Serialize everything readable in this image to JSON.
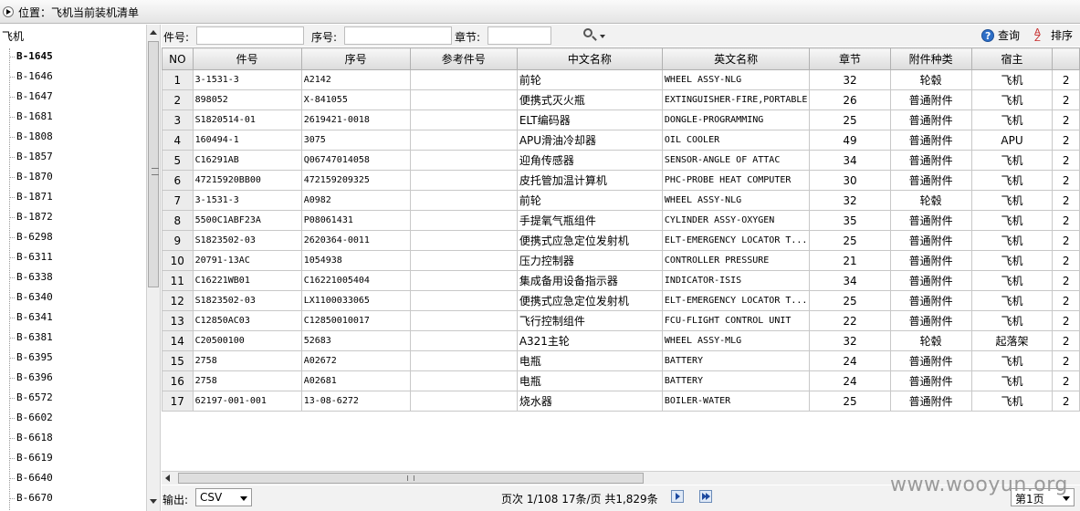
{
  "titlebar": {
    "location": "位置：飞机当前装机清单"
  },
  "tree": {
    "root": "飞机",
    "items": [
      "B-1645",
      "B-1646",
      "B-1647",
      "B-1681",
      "B-1808",
      "B-1857",
      "B-1870",
      "B-1871",
      "B-1872",
      "B-6298",
      "B-6311",
      "B-6338",
      "B-6340",
      "B-6341",
      "B-6381",
      "B-6395",
      "B-6396",
      "B-6572",
      "B-6602",
      "B-6618",
      "B-6619",
      "B-6640",
      "B-6670"
    ]
  },
  "filters": {
    "part_label": "件号:",
    "part_value": "",
    "serial_label": "序号:",
    "serial_value": "",
    "chapter_label": "章节:",
    "chapter_value": "",
    "query_label": "查询",
    "sort_label": "排序"
  },
  "table": {
    "columns": [
      "NO",
      "件号",
      "序号",
      "参考件号",
      "中文名称",
      "英文名称",
      "章节",
      "附件种类",
      "宿主"
    ],
    "rows": [
      [
        "1",
        "3-1531-3",
        "A2142",
        "",
        "前轮",
        "WHEEL ASSY-NLG",
        "32",
        "轮毂",
        "飞机",
        "2"
      ],
      [
        "2",
        "898052",
        "X-841055",
        "",
        "便携式灭火瓶",
        "EXTINGUISHER-FIRE,PORTABLE",
        "26",
        "普通附件",
        "飞机",
        "2"
      ],
      [
        "3",
        "S1820514-01",
        "2619421-0018",
        "",
        "ELT编码器",
        "DONGLE-PROGRAMMING",
        "25",
        "普通附件",
        "飞机",
        "2"
      ],
      [
        "4",
        "160494-1",
        "3075",
        "",
        "APU滑油冷却器",
        "OIL COOLER",
        "49",
        "普通附件",
        "APU",
        "2"
      ],
      [
        "5",
        "C16291AB",
        "Q06747014058",
        "",
        "迎角传感器",
        "SENSOR-ANGLE OF ATTAC",
        "34",
        "普通附件",
        "飞机",
        "2"
      ],
      [
        "6",
        "47215920BB00",
        "472159209325",
        "",
        "皮托管加温计算机",
        "PHC-PROBE HEAT COMPUTER",
        "30",
        "普通附件",
        "飞机",
        "2"
      ],
      [
        "7",
        "3-1531-3",
        "A0982",
        "",
        "前轮",
        "WHEEL ASSY-NLG",
        "32",
        "轮毂",
        "飞机",
        "2"
      ],
      [
        "8",
        "5500C1ABF23A",
        "P08061431",
        "",
        "手提氧气瓶组件",
        "CYLINDER ASSY-OXYGEN",
        "35",
        "普通附件",
        "飞机",
        "2"
      ],
      [
        "9",
        "S1823502-03",
        "2620364-0011",
        "",
        "便携式应急定位发射机",
        "ELT-EMERGENCY LOCATOR T...",
        "25",
        "普通附件",
        "飞机",
        "2"
      ],
      [
        "10",
        "20791-13AC",
        "1054938",
        "",
        "压力控制器",
        "CONTROLLER PRESSURE",
        "21",
        "普通附件",
        "飞机",
        "2"
      ],
      [
        "11",
        "C16221WB01",
        "C16221005404",
        "",
        "集成备用设备指示器",
        "INDICATOR-ISIS",
        "34",
        "普通附件",
        "飞机",
        "2"
      ],
      [
        "12",
        "S1823502-03",
        "LX1100033065",
        "",
        "便携式应急定位发射机",
        "ELT-EMERGENCY LOCATOR T...",
        "25",
        "普通附件",
        "飞机",
        "2"
      ],
      [
        "13",
        "C12850AC03",
        "C12850010017",
        "",
        "飞行控制组件",
        "FCU-FLIGHT CONTROL UNIT",
        "22",
        "普通附件",
        "飞机",
        "2"
      ],
      [
        "14",
        "C20500100",
        "52683",
        "",
        "A321主轮",
        "WHEEL ASSY-MLG",
        "32",
        "轮毂",
        "起落架",
        "2"
      ],
      [
        "15",
        "2758",
        "A02672",
        "",
        "电瓶",
        "BATTERY",
        "24",
        "普通附件",
        "飞机",
        "2"
      ],
      [
        "16",
        "2758",
        "A02681",
        "",
        "电瓶",
        "BATTERY",
        "24",
        "普通附件",
        "飞机",
        "2"
      ],
      [
        "17",
        "62197-001-001",
        "13-08-6272",
        "",
        "烧水器",
        "BOILER-WATER",
        "25",
        "普通附件",
        "飞机",
        "2"
      ]
    ]
  },
  "footer": {
    "output_label": "输出:",
    "output_format": "CSV",
    "page_info": "页次 1/108 17条/页 共1,829条",
    "page_select": "第1页"
  },
  "watermark": "www.wooyun.org"
}
